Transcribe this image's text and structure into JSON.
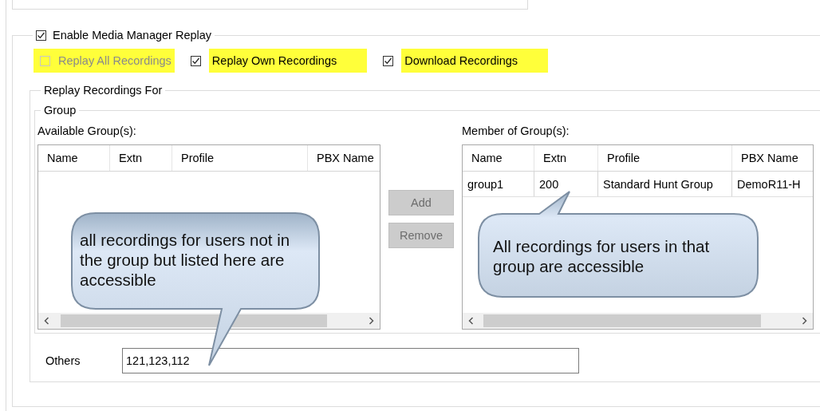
{
  "enable_replay": {
    "label": "Enable Media Manager Replay",
    "checked": true
  },
  "options": [
    {
      "label": "Replay All Recordings",
      "checked": false,
      "disabled": true,
      "highlighted": true
    },
    {
      "label": "Replay Own Recordings",
      "checked": true,
      "disabled": false,
      "highlighted": true
    },
    {
      "label": "Download Recordings",
      "checked": true,
      "disabled": false,
      "highlighted": true
    }
  ],
  "replay_for": {
    "title": "Replay Recordings For",
    "group": {
      "title": "Group",
      "available": {
        "label": "Available Group(s):",
        "columns": [
          "Name",
          "Extn",
          "Profile",
          "PBX Name"
        ]
      },
      "buttons": [
        {
          "label": "Add",
          "disabled": true
        },
        {
          "label": "Remove",
          "disabled": true
        }
      ],
      "member": {
        "label": "Member of Group(s):",
        "columns": [
          "Name",
          "Extn",
          "Profile",
          "PBX Name"
        ],
        "rows": [
          [
            "group1",
            "200",
            "Standard Hunt Group",
            "DemoR11-H"
          ]
        ]
      }
    },
    "others": {
      "label": "Others",
      "value": "121,123,112"
    }
  },
  "callouts": [
    {
      "text": "all recordings for users not in the group but listed here are accessible"
    },
    {
      "text": "All recordings for users in that group are accessible"
    }
  ]
}
